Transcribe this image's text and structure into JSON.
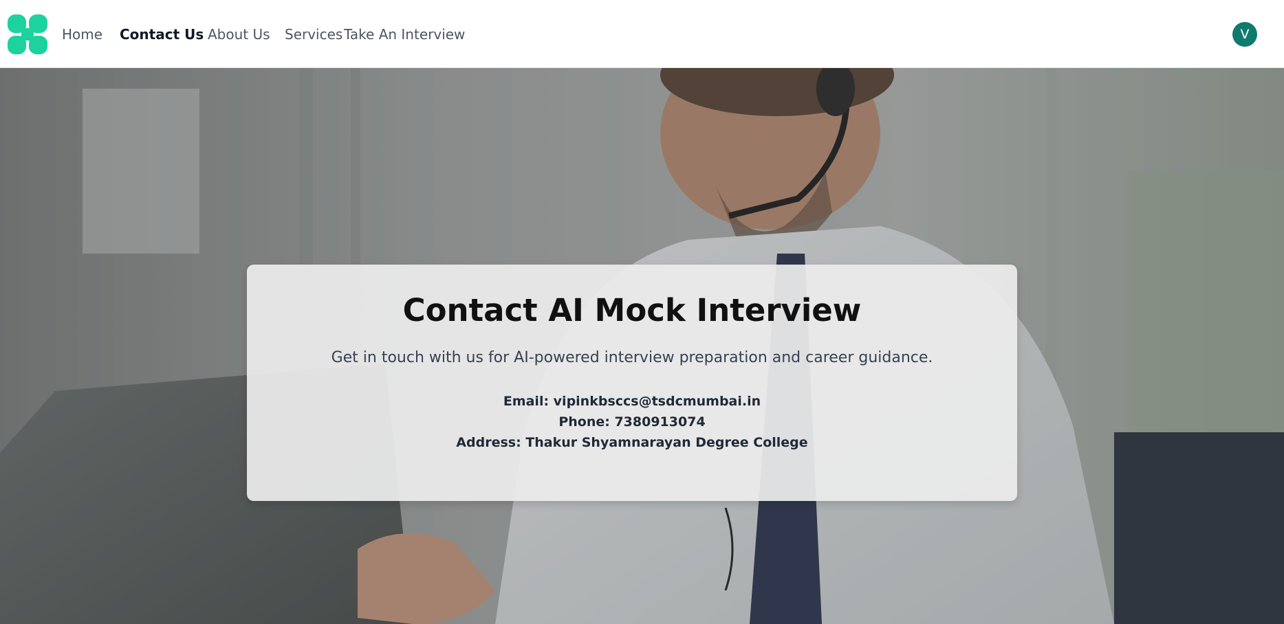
{
  "nav": {
    "logo": "logo-icon",
    "links": [
      {
        "label": "Home"
      },
      {
        "label": "Contact Us"
      },
      {
        "label": "About Us"
      },
      {
        "label": "Services"
      },
      {
        "label": "Take An Interview"
      }
    ],
    "active": "Contact Us",
    "avatar_initial": "V"
  },
  "card": {
    "title": "Contact AI Mock Interview",
    "subtitle": "Get in touch with us for AI-powered interview preparation and career guidance.",
    "email": "Email: vipinkbsccs@tsdcmumbai.in",
    "phone": "Phone: 7380913074",
    "address": "Address: Thakur Shyamnarayan Degree College"
  },
  "colors": {
    "brand": "#1dd29f",
    "avatar": "#0f7a6e"
  }
}
